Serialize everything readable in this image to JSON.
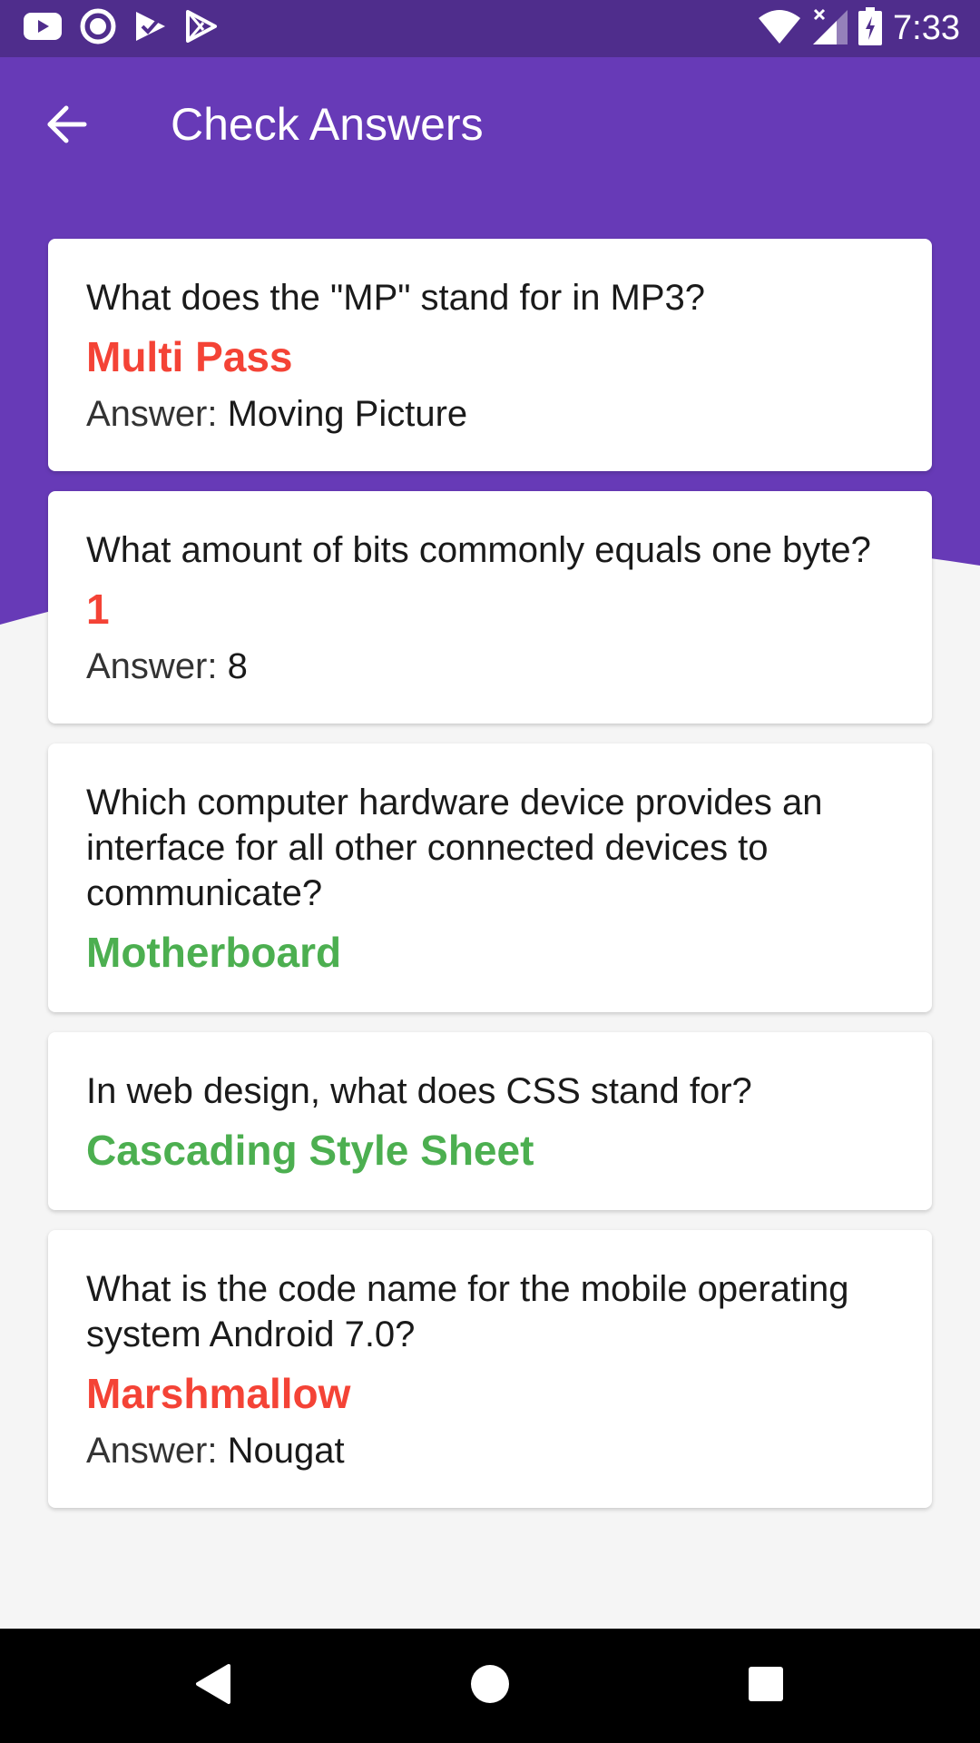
{
  "status_bar": {
    "time": "7:33",
    "left_icons": [
      "youtube-icon",
      "podcast-icon",
      "tasks-icon",
      "play-store-icon"
    ],
    "right_icons": [
      "wifi-icon",
      "cell-signal-icon",
      "battery-charging-icon"
    ]
  },
  "app_bar": {
    "title": "Check Answers",
    "back_icon": "arrow-back-icon"
  },
  "answer_prefix": "Answer: ",
  "cards": [
    {
      "question": "What does the \"MP\" stand for in MP3?",
      "selected": "Multi Pass",
      "correct": false,
      "answer": "Moving Picture"
    },
    {
      "question": "What amount of bits commonly equals one byte?",
      "selected": "1",
      "correct": false,
      "answer": "8"
    },
    {
      "question": "Which computer hardware device provides an interface for all other connected devices to communicate?",
      "selected": "Motherboard",
      "correct": true
    },
    {
      "question": "In web design, what does CSS stand for?",
      "selected": "Cascading Style Sheet",
      "correct": true
    },
    {
      "question": "What is the code name for the mobile operating system Android 7.0?",
      "selected": "Marshmallow",
      "correct": false,
      "answer": "Nougat"
    }
  ],
  "nav_bar": {
    "icons": [
      "back-triangle-icon",
      "home-circle-icon",
      "recents-square-icon"
    ]
  },
  "colors": {
    "status_bar": "#4f2d8c",
    "primary": "#673ab7",
    "wrong": "#f44336",
    "correct": "#4caf50",
    "background": "#f5f5f5"
  }
}
